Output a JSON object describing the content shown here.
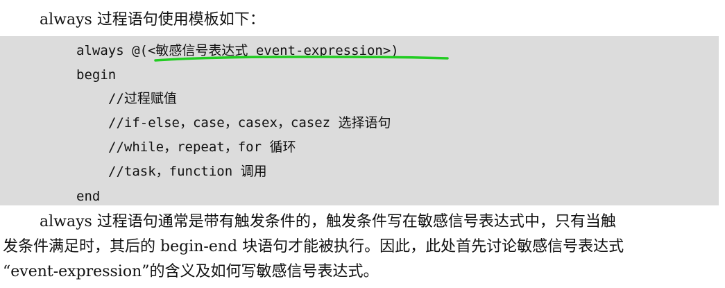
{
  "intro": "always 过程语句使用模板如下：",
  "code": {
    "lines": [
      "always @(<敏感信号表达式 event-expression>)",
      "begin",
      "//过程赋值",
      "//if-else，case，casex，casez 选择语句",
      "//while，repeat，for 循环",
      "//task，function 调用",
      "end"
    ],
    "highlight_color": "#22cc22",
    "background_color": "#dcdcdc"
  },
  "paragraph": {
    "lines": [
      "always 过程语句通常是带有触发条件的，触发条件写在敏感信号表达式中，只有当触",
      "发条件满足时，其后的 begin-end 块语句才能被执行。因此，此处首先讨论敏感信号表达式",
      "“event-expression”的含义及如何写敏感信号表达式。"
    ]
  }
}
